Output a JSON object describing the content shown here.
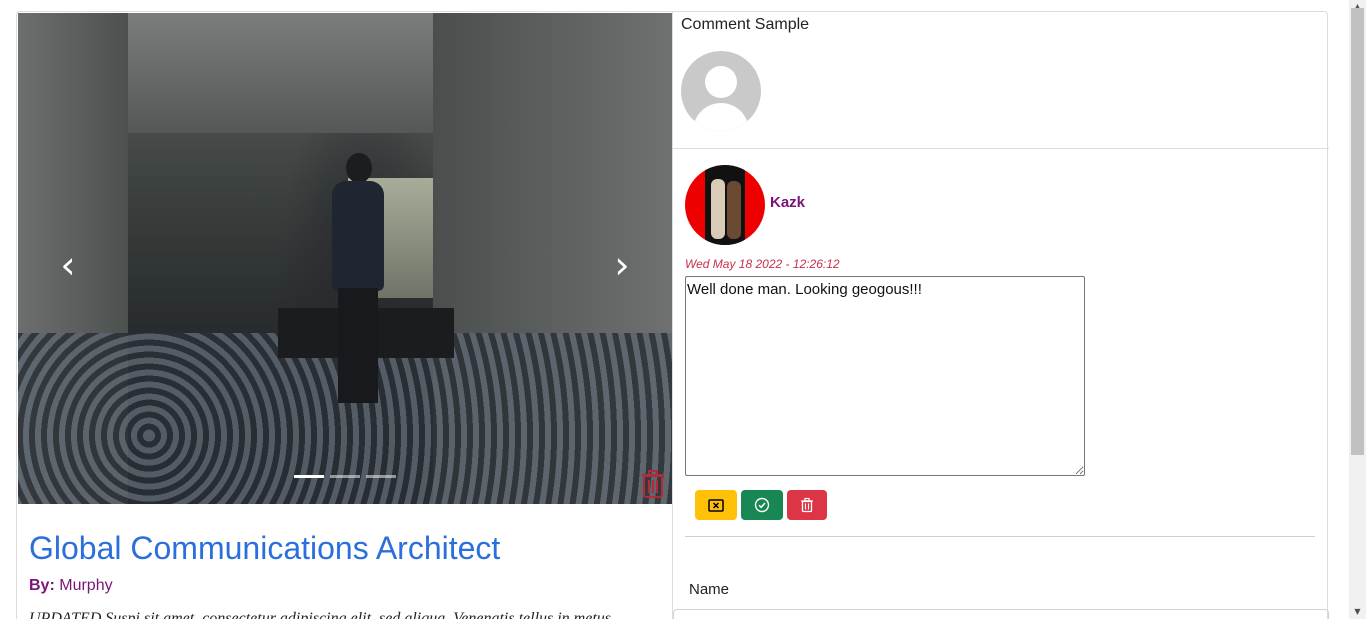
{
  "carousel": {
    "prev_glyph": "‹",
    "next_glyph": "›",
    "slide_count": 3,
    "active_slide": 1
  },
  "post": {
    "title": "Global Communications Architect",
    "by_label": "By:",
    "author": "Murphy",
    "excerpt": "UPDATED Suspi sit amet, consectetur adipiscing elit, sed aliqua. Venenatis tellus in metus"
  },
  "comments": {
    "section_label": "Comment Sample",
    "entry": {
      "user": "Kazk",
      "date": "Wed May 18 2022 - 12:26:12",
      "text": "Well done man. Looking geogous!!!"
    }
  },
  "form": {
    "name_label": "Name"
  },
  "colors": {
    "title": "#2a6fdb",
    "author": "#7b1479",
    "date": "#c8304a",
    "cancel": "#ffc107",
    "confirm": "#198754",
    "delete": "#dc3545"
  },
  "icons": {
    "cancel": "x-square-icon",
    "confirm": "check-circle-icon",
    "delete": "trash-icon",
    "slide_delete": "trash-icon"
  }
}
